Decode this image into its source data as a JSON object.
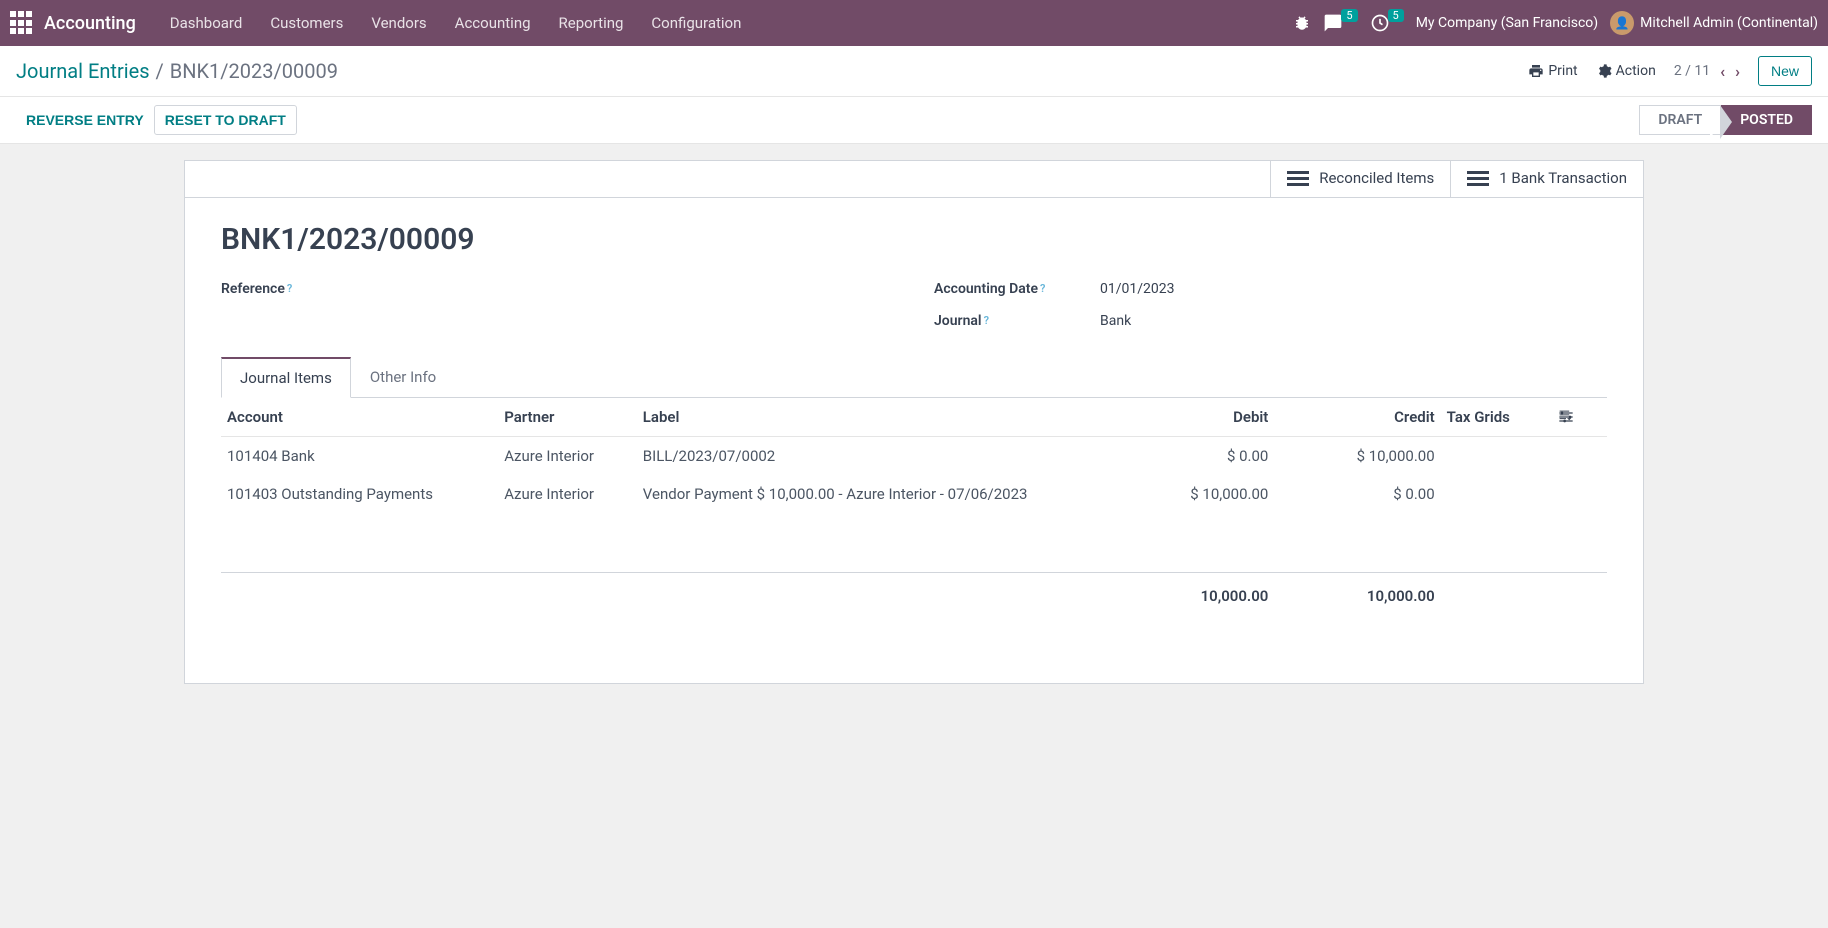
{
  "nav": {
    "brand": "Accounting",
    "items": [
      "Dashboard",
      "Customers",
      "Vendors",
      "Accounting",
      "Reporting",
      "Configuration"
    ],
    "msg_badge": "5",
    "activity_badge": "5",
    "company": "My Company (San Francisco)",
    "user": "Mitchell Admin (Continental)"
  },
  "breadcrumb": {
    "parent": "Journal Entries",
    "current": "BNK1/2023/00009"
  },
  "toolbar": {
    "print": "Print",
    "action": "Action",
    "pager": "2 / 11",
    "new": "New"
  },
  "statusbar": {
    "reverse": "REVERSE ENTRY",
    "reset": "RESET TO DRAFT",
    "draft": "DRAFT",
    "posted": "POSTED"
  },
  "stat_buttons": {
    "reconciled": "Reconciled Items",
    "bank": "1 Bank Transaction"
  },
  "entry": {
    "name": "BNK1/2023/00009",
    "ref_label": "Reference",
    "ref_value": "",
    "date_label": "Accounting Date",
    "date_value": "01/01/2023",
    "journal_label": "Journal",
    "journal_value": "Bank"
  },
  "tabs": {
    "items": "Journal Items",
    "other": "Other Info"
  },
  "table": {
    "headers": {
      "account": "Account",
      "partner": "Partner",
      "label": "Label",
      "debit": "Debit",
      "credit": "Credit",
      "tax": "Tax Grids"
    },
    "rows": [
      {
        "account": "101404 Bank",
        "partner": "Azure Interior",
        "label": "BILL/2023/07/0002",
        "debit": "$ 0.00",
        "credit": "$ 10,000.00",
        "tax": ""
      },
      {
        "account": "101403 Outstanding Payments",
        "partner": "Azure Interior",
        "label": "Vendor Payment $ 10,000.00 - Azure Interior - 07/06/2023",
        "debit": "$ 10,000.00",
        "credit": "$ 0.00",
        "tax": ""
      }
    ],
    "totals": {
      "debit": "10,000.00",
      "credit": "10,000.00"
    }
  }
}
